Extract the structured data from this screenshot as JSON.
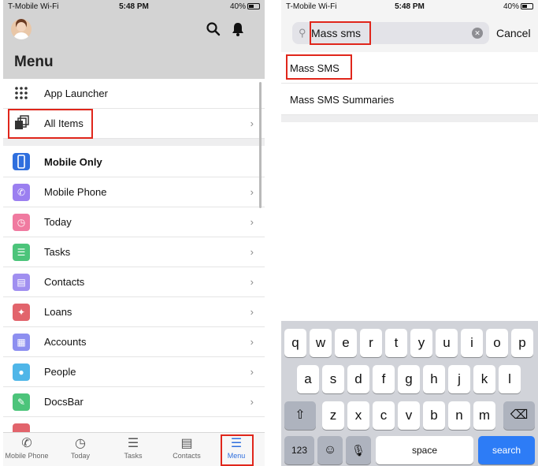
{
  "left": {
    "status": {
      "carrier": "T-Mobile Wi-Fi",
      "time": "5:48 PM",
      "battery": "40%"
    },
    "header": {
      "title": "Menu",
      "search_icon": "search-icon",
      "bell_icon": "bell-icon"
    },
    "items": [
      {
        "label": "App Launcher",
        "icon": "grid-icon",
        "chevron": ""
      },
      {
        "label": "All Items",
        "icon": "stack-icon",
        "chevron": "›"
      },
      {
        "label": "Mobile Only",
        "icon": "phone-device-icon",
        "chevron": ""
      },
      {
        "label": "Mobile Phone",
        "icon": "phone-icon",
        "chevron": "›",
        "color": "#9b7ff0"
      },
      {
        "label": "Today",
        "icon": "clock-icon",
        "chevron": "›",
        "color": "#f07aa0"
      },
      {
        "label": "Tasks",
        "icon": "tasks-icon",
        "chevron": "›",
        "color": "#4cc47a"
      },
      {
        "label": "Contacts",
        "icon": "contact-card-icon",
        "chevron": "›",
        "color": "#a08ff0"
      },
      {
        "label": "Loans",
        "icon": "wrench-icon",
        "chevron": "›",
        "color": "#e2646c"
      },
      {
        "label": "Accounts",
        "icon": "building-icon",
        "chevron": "›",
        "color": "#8d8ff0"
      },
      {
        "label": "People",
        "icon": "person-icon",
        "chevron": "›",
        "color": "#4fb6e8"
      },
      {
        "label": "DocsBar",
        "icon": "docs-icon",
        "chevron": "›",
        "color": "#4cc47a"
      }
    ],
    "tabs": [
      {
        "label": "Mobile Phone",
        "icon": "phone-icon"
      },
      {
        "label": "Today",
        "icon": "clock-icon"
      },
      {
        "label": "Tasks",
        "icon": "tasks-icon"
      },
      {
        "label": "Contacts",
        "icon": "contact-card-icon"
      },
      {
        "label": "Menu",
        "icon": "menu-icon"
      }
    ]
  },
  "right": {
    "status": {
      "carrier": "T-Mobile Wi-Fi",
      "time": "5:48 PM",
      "battery": "40%"
    },
    "search": {
      "value": "Mass sms",
      "cancel_label": "Cancel"
    },
    "results": [
      "Mass SMS",
      "Mass SMS Summaries"
    ],
    "keyboard": {
      "row1": [
        "q",
        "w",
        "e",
        "r",
        "t",
        "y",
        "u",
        "i",
        "o",
        "p"
      ],
      "row2": [
        "a",
        "s",
        "d",
        "f",
        "g",
        "h",
        "j",
        "k",
        "l"
      ],
      "row3": [
        "z",
        "x",
        "c",
        "v",
        "b",
        "n",
        "m"
      ],
      "numbers_label": "123",
      "space_label": "space",
      "search_label": "search"
    }
  },
  "colors": {
    "highlight": "#e0261b",
    "accent": "#2f6fde",
    "keyboard_bg": "#d1d3d9"
  }
}
